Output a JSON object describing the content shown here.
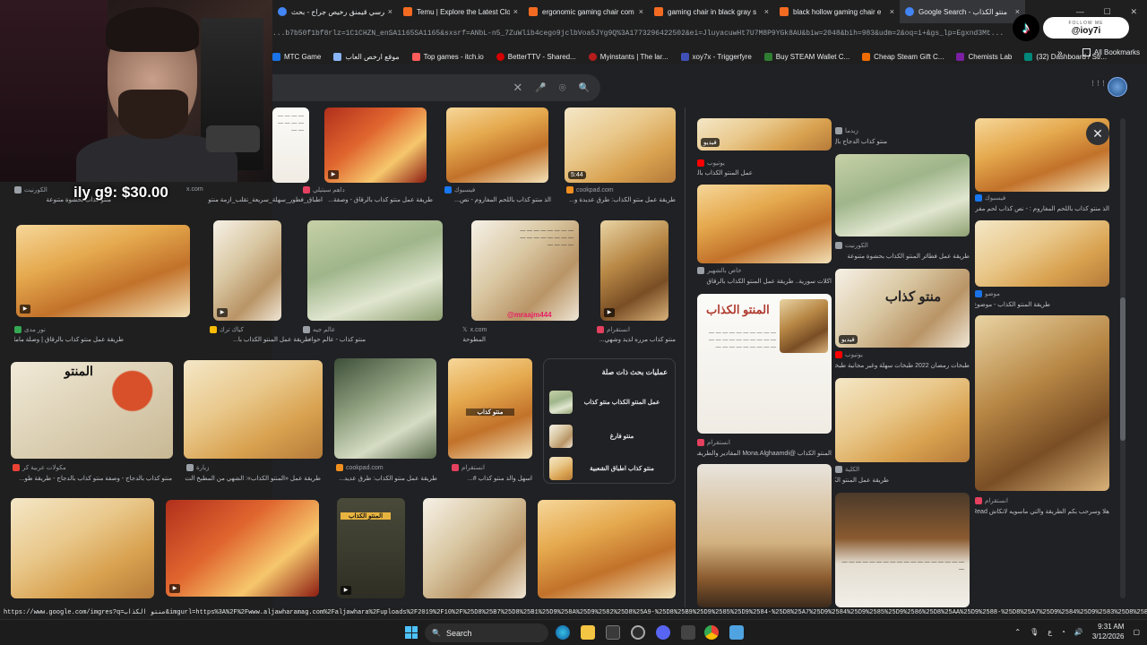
{
  "tabs": [
    {
      "label": "كرسي قيمنق رخيص جراح - بحث",
      "color": "#4285f4"
    },
    {
      "label": "Temu | Explore the Latest Clo",
      "color": "#f26b21"
    },
    {
      "label": "ergonomic gaming chair com",
      "color": "#f26b21"
    },
    {
      "label": "gaming chair in black gray s",
      "color": "#f26b21"
    },
    {
      "label": "black hollow gaming chair e",
      "color": "#f26b21"
    },
    {
      "label": "Google Search - منتو الكذاب",
      "color": "#4285f4"
    }
  ],
  "tab_close": "×",
  "window_controls": [
    "—",
    "☐",
    "✕"
  ],
  "tiktok": {
    "follow_text": "FOLLOW ME",
    "handle": "@ioy7i",
    "logo": "♪"
  },
  "url": "...b7b50f1bf8rlz=1C1CHZN_enSA1165SA1165&sxsrf=ANbL-n5_7ZuWlib4cego9jclbVoa5JYg9Q%3A1773296422502&ei=JluyacuwHt7U7M8P9YGk8AU&biw=2048&bih=983&udm=2&oq=i+&gs_lp=Egxnd3Mt...",
  "bookmarks": [
    {
      "label": "MTC Game",
      "color": "#1a73e8"
    },
    {
      "label": "موقع ارخص العاب",
      "color": "#8ab4f8"
    },
    {
      "label": "Top games - itch.io",
      "color": "#fa5c5c"
    },
    {
      "label": "BetterTTV - Shared...",
      "color": "#d50000"
    },
    {
      "label": "Myinstants | The lar...",
      "color": "#b71c1c"
    },
    {
      "label": "xoy7x - Triggerfyre",
      "color": "#3f51b5"
    },
    {
      "label": "Buy STEAM Wallet C...",
      "color": "#2e7d32"
    },
    {
      "label": "Cheap Steam Gift C...",
      "color": "#ef6c00"
    },
    {
      "label": "Chemists Lab",
      "color": "#7b1fa2"
    },
    {
      "label": "(32) Dashboard / Str...",
      "color": "#00897b"
    }
  ],
  "bookmarks_more": "»",
  "all_bookmarks": "All Bookmarks",
  "search": {
    "clear": "✕",
    "mic": "🎤",
    "lens": "⌾",
    "search": "🔍"
  },
  "apps_icon": "⋮⋮⋮",
  "donation_text": "ily g9: $30.00",
  "grid_row1": [
    {
      "source": "x.com",
      "caption": "...",
      "color": "#9aa0a6"
    },
    {
      "source": "داهم سيتيلي",
      "caption": "اطباق_فطور_سهلة_سريعة_تقلب_ازمة منتو",
      "color": "#e4405f"
    },
    {
      "source": "فيسبوك",
      "caption": "طريقة عمل منتو كذاب بالرقاق - وصفة...",
      "color": "#1877f2"
    },
    {
      "source": "cookpad.com",
      "caption": "الذ منتو كذاب باللحم المفاروم - نص...",
      "color": "#f18f1e"
    },
    {
      "source": "",
      "caption": "طريقة عمل منتو الكذاب: طرق عديدة و...",
      "color": "#9aa0a6"
    }
  ],
  "row1_first_caption": "منتو كذاب بحشوة متنوعة",
  "row1_first_source": "الكورنيت",
  "row1_duration": "5:44",
  "grid_row2": [
    {
      "source": "نور مدى",
      "caption": "طريقة عمل منتو كذاب بالرقاق | وصلة ماما",
      "color": "#34a853"
    },
    {
      "source": "كياك ترك",
      "caption": "طريقة عمل المنتو الكذاب با...",
      "color": "#fbbc04"
    },
    {
      "source": "عالم جيه",
      "caption": "منتو كذاب - عالم حواء",
      "color": "#9aa0a6"
    },
    {
      "source": "x.com",
      "caption": "المطوحة",
      "color": "#9aa0a6"
    },
    {
      "source": "انستقرام",
      "caption": "منتو كذاب مرره لذيذ وشهي...",
      "color": "#e4405f"
    }
  ],
  "row2_watermark": "@mraajm444",
  "grid_row3": [
    {
      "source": "مكولات عربية كر",
      "caption": "منتو كذاب بالدجاج - وصفة منتو كذاب بالدجاج - طريقة طو...",
      "color": "#ea4335"
    },
    {
      "source": "زيارة",
      "caption": "طريقة عمل «المنتو الكذاب»: الشهي من المطبخ الت...",
      "color": "#9aa0a6"
    },
    {
      "source": "cookpad.com",
      "caption": "طريقة عمل منتو الكذاب: طرق عديد...",
      "color": "#f18f1e"
    },
    {
      "source": "انستقرام",
      "caption": "اسهل والذ منتو كذاب #...",
      "color": "#e4405f"
    }
  ],
  "row3_overlay_title": "المنتو",
  "row3_small_overlay": "منتو كذاب",
  "related": {
    "title": "عمليات بحث ذات صلة",
    "items": [
      {
        "label": "عمل المنتو الكذاب منتو كذاب"
      },
      {
        "label": "منتو فارغ"
      },
      {
        "label": "منتو كذاب اطباق الشعبية"
      }
    ]
  },
  "row4_overlay": "المنتو الكذاب",
  "right_panel": {
    "close_icon": "✕",
    "col1": [
      {
        "source": "يوتيوب",
        "caption": "عمل المنتو الكذاب بالرمدت",
        "color": "#ff0000",
        "badge": "فيديو"
      },
      {
        "source": "خاص بالشهير",
        "caption": "اكلات سورية.. طريقة عمل المنتو الكذاب بالرقاق",
        "color": "#9aa0a6"
      },
      {
        "source": "انستقرام",
        "caption": "المنتو الكذاب @Mona.Alghaamdi المقادير والطريقة",
        "color": "#e4405f"
      }
    ],
    "col1_doc_title": "المنتو الكذاب",
    "col2": [
      {
        "source": "زيدما",
        "caption": "منتو كذاب الدجاج بال",
        "color": "#9aa0a6"
      },
      {
        "source": "الكورنيت",
        "caption": "طريقة عمل فطائر المنتو الكذاب بحشوة متنوعة",
        "color": "#9aa0a6"
      },
      {
        "source": "يوتيوب",
        "caption": "طبخات رمضان 2022 طبخات سهلة وغير مجانية طبخات",
        "color": "#ff0000",
        "badge": "فيديو"
      },
      {
        "source": "الكلية",
        "caption": "طريقة عمل المنتو الكذاب",
        "color": "#9aa0a6"
      }
    ],
    "col2_overlay": "منتو كذاب",
    "col3": [
      {
        "source": "فيسبوك",
        "caption": "الذ منتو كذاب باللحم المفاروم : - نص كذاب لحم مفروم - ملح...",
        "color": "#1877f2"
      },
      {
        "source": "موضو",
        "caption": "طريقة المنتو الكذاب - موضوع",
        "color": "#1a73e8"
      },
      {
        "source": "انستقرام",
        "caption": "هلا وسرحب بكم الطريقة والتي ماسويه لانكاش Read",
        "color": "#e4405f"
      }
    ]
  },
  "status_url": "https://www.google.com/imgres?q=منتو الكذاب&imgurl=https%3A%2F%2Fwww.aljawharamag.com%2Faljawhara%2Fuploads%2F2019%2F10%2F%25D8%25B7%25D8%25B1%25D9%258A%25D9%2582%25D8%25A9-%25D8%25B9%25D9%2585%25D9%2584-%25D8%25A7%25D9%2584%25D9%2585%25D9%2586%25D8%25AA%25D9%2588-%25D8%25A7%25D9%2584%25D9%2583%25D8%25B0%25D8%25A7%25D8%25A8.jpg",
  "taskbar": {
    "search_placeholder": "Search",
    "time": "9:31 AM",
    "date": "3/12/2026",
    "lang": "ع"
  }
}
